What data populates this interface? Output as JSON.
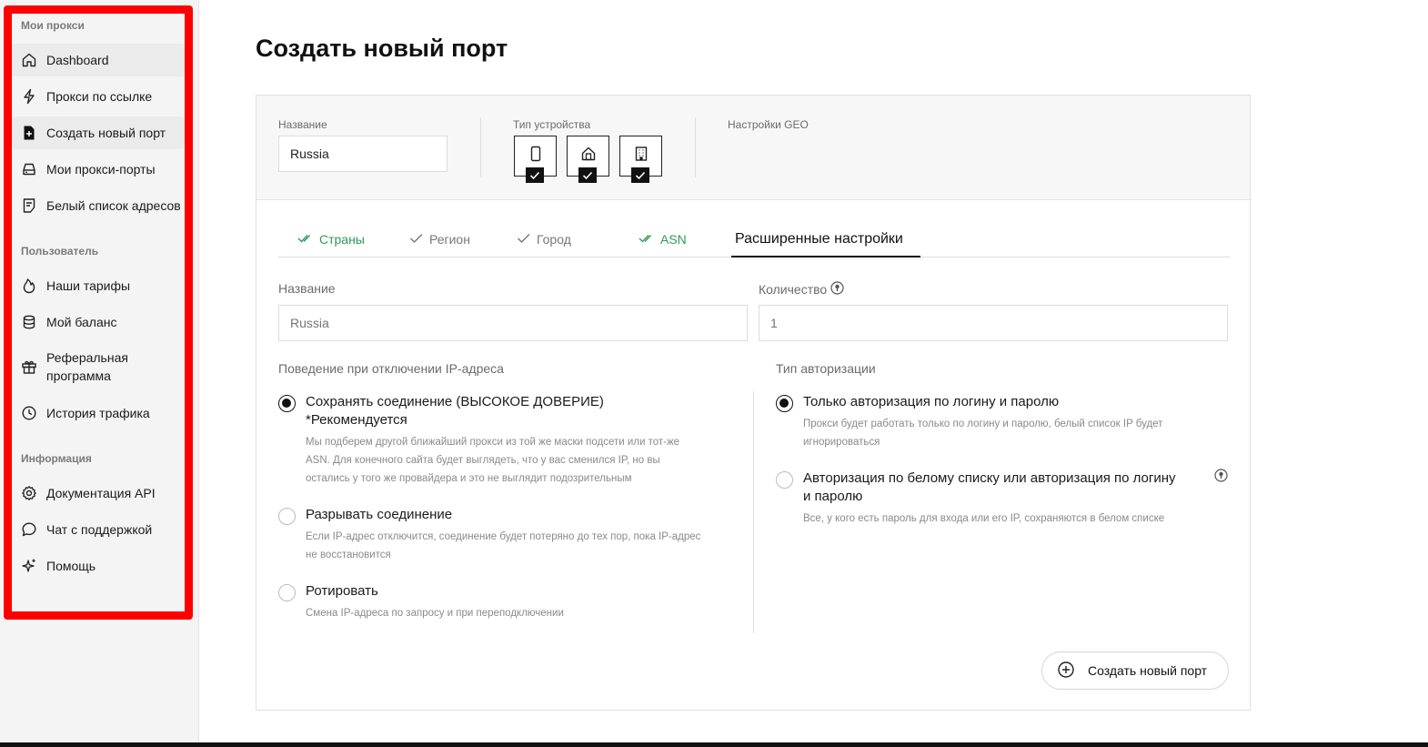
{
  "sidebar": {
    "sections": [
      {
        "title": "Мои прокси"
      },
      {
        "title": "Пользователь"
      },
      {
        "title": "Информация"
      }
    ],
    "items": [
      {
        "label": "Dashboard",
        "icon": "home-icon"
      },
      {
        "label": "Прокси по ссылке",
        "icon": "lightning-icon"
      },
      {
        "label": "Создать новый порт",
        "icon": "file-plus-icon"
      },
      {
        "label": "Мои прокси-порты",
        "icon": "server-icon"
      },
      {
        "label": "Белый список адресов",
        "icon": "list-doc-icon"
      },
      {
        "label": "Наши тарифы",
        "icon": "flame-icon"
      },
      {
        "label": "Мой баланс",
        "icon": "coins-icon"
      },
      {
        "label": "Реферальная программа",
        "icon": "gift-icon"
      },
      {
        "label": "История трафика",
        "icon": "clock-icon"
      },
      {
        "label": "Документация API",
        "icon": "gear-icon"
      },
      {
        "label": "Чат с поддержкой",
        "icon": "chat-icon"
      },
      {
        "label": "Помощь",
        "icon": "sparkle-icon"
      }
    ]
  },
  "page": {
    "title": "Создать новый порт"
  },
  "top_settings": {
    "name_label": "Название",
    "name_value": "Russia",
    "device_label": "Тип устройства",
    "devices": [
      "mobile-icon",
      "home-icon",
      "building-icon"
    ],
    "geo_label": "Настройки GEO"
  },
  "tabs": [
    {
      "label": "Страны",
      "state": "done"
    },
    {
      "label": "Регион",
      "state": "pending"
    },
    {
      "label": "Город",
      "state": "pending"
    },
    {
      "label": "ASN",
      "state": "done"
    },
    {
      "label": "Расширенные настройки",
      "state": "active"
    }
  ],
  "form": {
    "name_label": "Название",
    "name_placeholder": "Russia",
    "qty_label": "Количество",
    "qty_placeholder": "1"
  },
  "disconnect": {
    "label": "Поведение при отключении IP-адреса",
    "options": [
      {
        "title": "Сохранять соединение (ВЫСОКОЕ ДОВЕРИЕ) *Рекомендуется",
        "desc": "Мы подберем другой ближайший прокси из той же маски подсети или тот-же ASN. Для конечного сайта будет выглядеть, что у вас сменился IP, но вы остались у того же провайдера и это не выглядит подозрительным",
        "selected": true
      },
      {
        "title": "Разрывать соединение",
        "desc": "Если IP-адрес отключится, соединение будет потеряно до тех пор, пока IP-адрес не восстановится",
        "selected": false
      },
      {
        "title": "Ротировать",
        "desc": "Смена IP-адреса по запросу и при переподключении",
        "selected": false
      }
    ]
  },
  "auth": {
    "label": "Тип авторизации",
    "options": [
      {
        "title": "Только авторизация по логину и паролю",
        "desc": "Прокси будет работать только по логину и паролю, белый список IP будет игнорироваться",
        "selected": true
      },
      {
        "title": "Авторизация по белому списку или авторизация по логину и паролю",
        "desc": "Все, у кого есть пароль для входа или его IP, сохраняются в белом списке",
        "selected": false
      }
    ]
  },
  "actions": {
    "create_label": "Создать новый порт"
  },
  "colors": {
    "accent_green": "#2e9b57",
    "highlight_red": "#ff0000"
  }
}
